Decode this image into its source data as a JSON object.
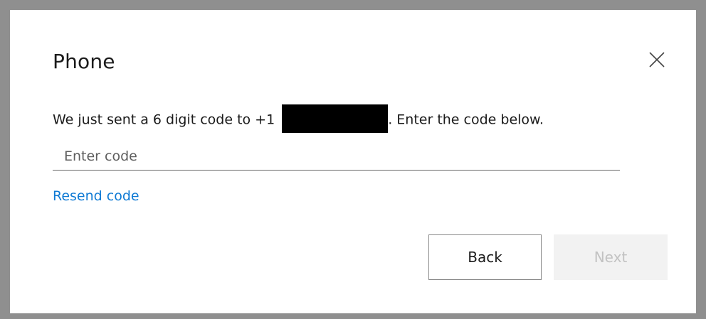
{
  "dialog": {
    "title": "Phone",
    "message_prefix": "We just sent a 6 digit code to +1",
    "message_suffix": ". Enter the code below.",
    "code_input": {
      "placeholder": "Enter code",
      "value": ""
    },
    "resend_label": "Resend code",
    "back_label": "Back",
    "next_label": "Next",
    "next_disabled": true
  },
  "icons": {
    "close": "close-icon"
  },
  "colors": {
    "link": "#0f7ad4",
    "text": "#1b1b1b",
    "disabled_bg": "#f2f2f2",
    "disabled_text": "#c2c2c2",
    "redaction": "#000000"
  }
}
